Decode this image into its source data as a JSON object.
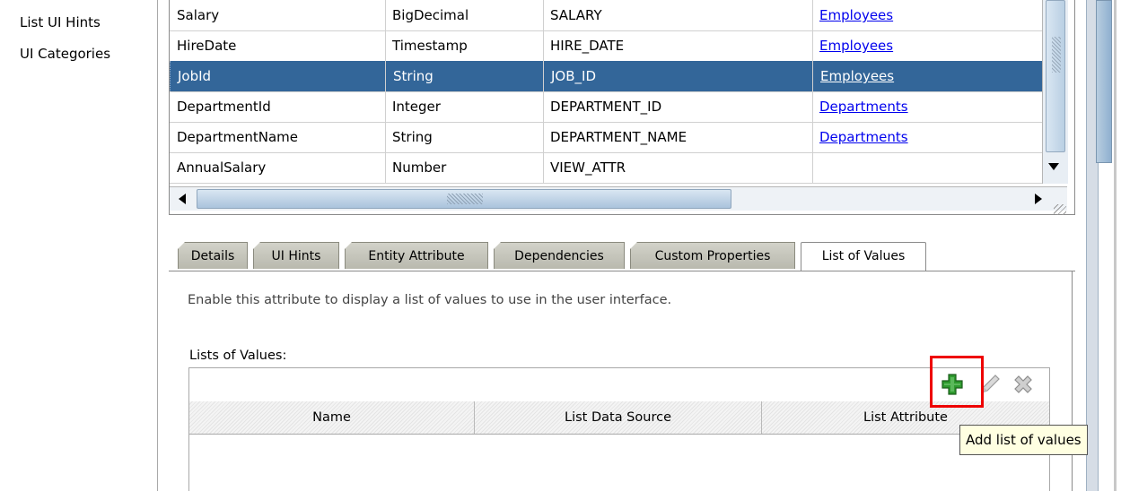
{
  "nav": {
    "items": [
      "List UI Hints",
      "UI Categories"
    ]
  },
  "grid": {
    "rows": [
      {
        "name": "Salary",
        "type": "BigDecimal",
        "column": "SALARY",
        "entity": "Employees"
      },
      {
        "name": "HireDate",
        "type": "Timestamp",
        "column": "HIRE_DATE",
        "entity": "Employees"
      },
      {
        "name": "JobId",
        "type": "String",
        "column": "JOB_ID",
        "entity": "Employees"
      },
      {
        "name": "DepartmentId",
        "type": "Integer",
        "column": "DEPARTMENT_ID",
        "entity": "Departments"
      },
      {
        "name": "DepartmentName",
        "type": "String",
        "column": "DEPARTMENT_NAME",
        "entity": "Departments"
      },
      {
        "name": "AnnualSalary",
        "type": "Number",
        "column": "VIEW_ATTR",
        "entity": ""
      }
    ],
    "selected_row": "JobId"
  },
  "tabs": [
    "Details",
    "UI Hints",
    "Entity Attribute",
    "Dependencies",
    "Custom Properties",
    "List of Values"
  ],
  "active_tab": "List of Values",
  "panel": {
    "hint": "Enable this attribute to display a list of values to use in the user interface.",
    "lov_label": "Lists of Values:",
    "columns": [
      "Name",
      "List Data Source",
      "List Attribute"
    ]
  },
  "tooltip": "Add list of values",
  "colors": {
    "selection": "#336699",
    "highlight": "#ee0000",
    "add_icon": "#2e9a2e"
  },
  "icons": [
    "add-icon",
    "edit-icon",
    "delete-icon"
  ]
}
